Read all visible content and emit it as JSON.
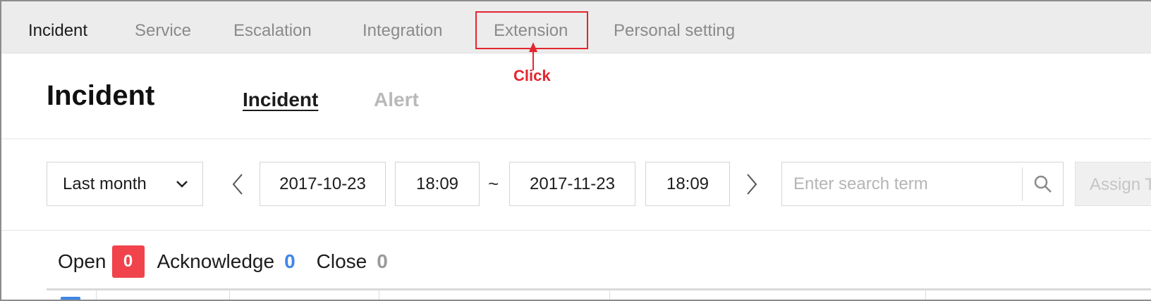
{
  "nav": {
    "items": [
      "Incident",
      "Service",
      "Escalation",
      "Integration",
      "Extension",
      "Personal setting"
    ]
  },
  "annotation": {
    "label": "Click",
    "color": "#e3262f"
  },
  "page": {
    "title": "Incident",
    "subtabs": [
      "Incident",
      "Alert"
    ]
  },
  "filters": {
    "range": "Last month",
    "start_date": "2017-10-23",
    "start_time": "18:09",
    "separator": "~",
    "end_date": "2017-11-23",
    "end_time": "18:09",
    "search_placeholder": "Enter search term",
    "assign_label": "Assign T"
  },
  "status": {
    "open_label": "Open",
    "open_count": "0",
    "ack_label": "Acknowledge",
    "ack_count": "0",
    "close_label": "Close",
    "close_count": "0"
  },
  "colors": {
    "accent_red": "#f0434b",
    "accent_blue": "#3f86e8",
    "nav_bg": "#ececec"
  }
}
